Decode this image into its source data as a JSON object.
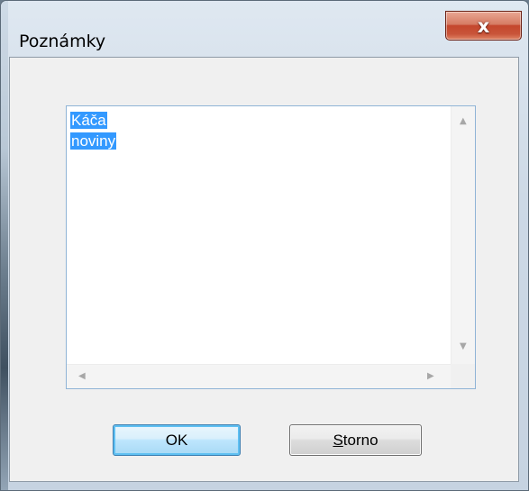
{
  "dialog": {
    "title": "Poznámky",
    "close_glyph": "x"
  },
  "notes": {
    "lines": [
      "Káča",
      "noviny"
    ],
    "selected": true
  },
  "scrollbars": {
    "up_arrow": "▲",
    "down_arrow": "▼",
    "left_arrow": "◀",
    "right_arrow": "▶"
  },
  "buttons": {
    "ok_label": "OK",
    "storno_mnemonic": "S",
    "storno_rest": "torno"
  },
  "colors": {
    "selection": "#3399ff",
    "close_button": "#c4462c",
    "default_button_border": "#3c7fb1"
  }
}
